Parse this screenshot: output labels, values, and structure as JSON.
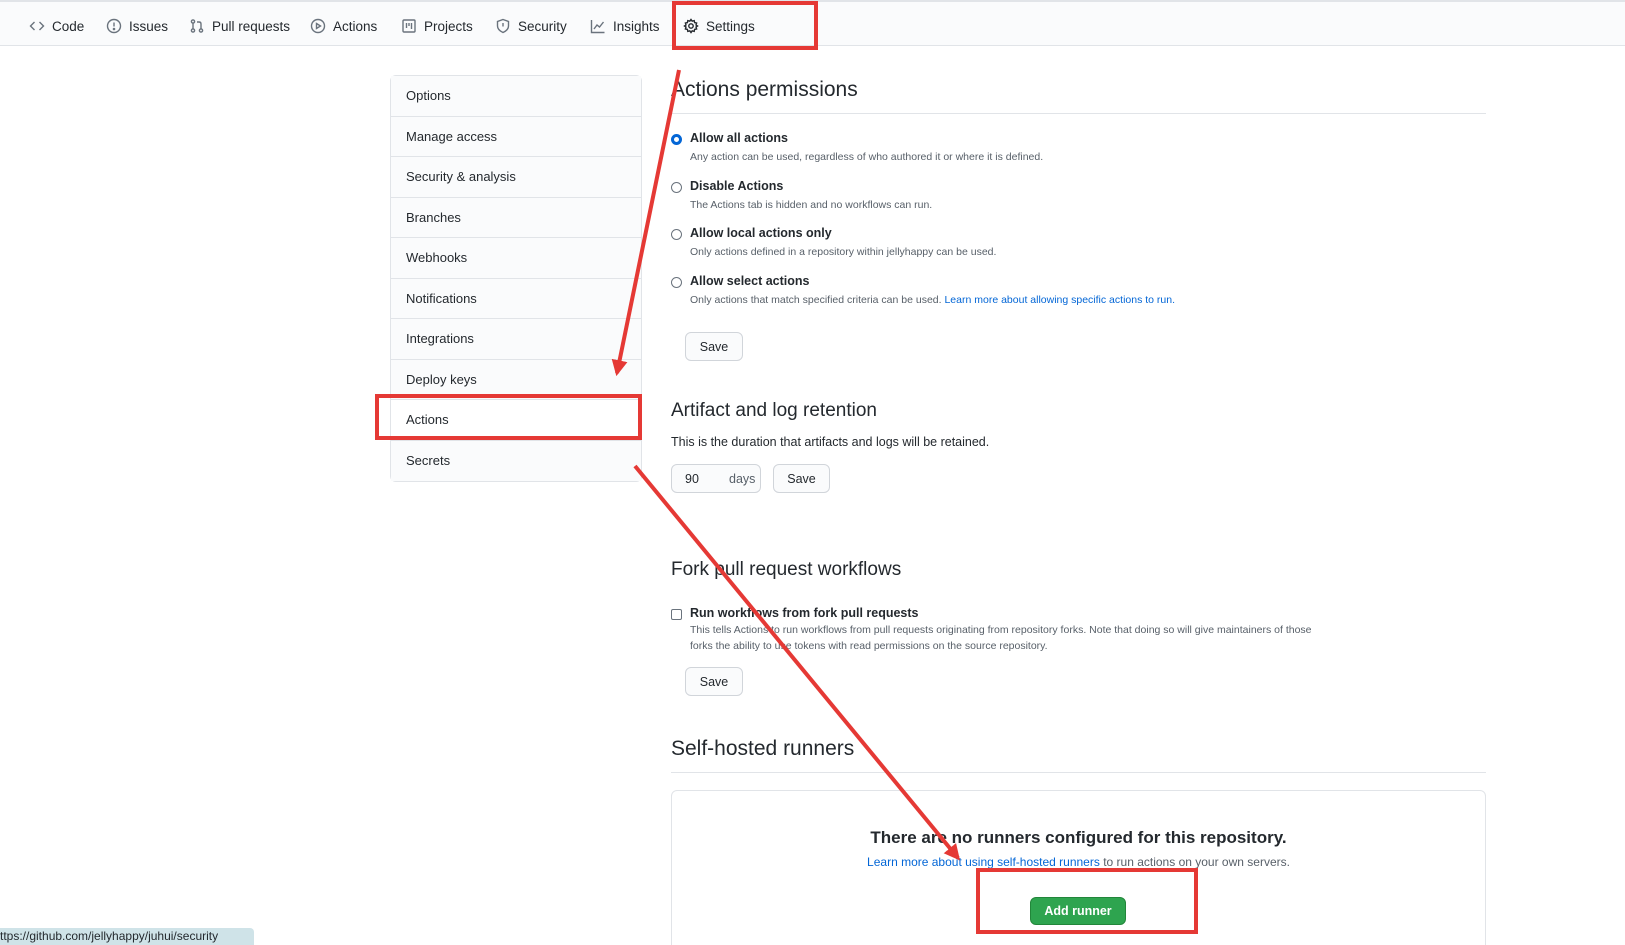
{
  "tabs": [
    {
      "label": "Code",
      "icon": "code-icon"
    },
    {
      "label": "Issues",
      "icon": "issue-icon"
    },
    {
      "label": "Pull requests",
      "icon": "pull-request-icon"
    },
    {
      "label": "Actions",
      "icon": "play-icon"
    },
    {
      "label": "Projects",
      "icon": "project-icon"
    },
    {
      "label": "Security",
      "icon": "shield-icon"
    },
    {
      "label": "Insights",
      "icon": "graph-icon"
    },
    {
      "label": "Settings",
      "icon": "gear-icon",
      "selected": true
    }
  ],
  "sidebar": {
    "items": [
      {
        "label": "Options"
      },
      {
        "label": "Manage access"
      },
      {
        "label": "Security & analysis"
      },
      {
        "label": "Branches"
      },
      {
        "label": "Webhooks"
      },
      {
        "label": "Notifications"
      },
      {
        "label": "Integrations"
      },
      {
        "label": "Deploy keys"
      },
      {
        "label": "Actions",
        "active": true
      },
      {
        "label": "Secrets"
      }
    ]
  },
  "permissions": {
    "title": "Actions permissions",
    "options": [
      {
        "title": "Allow all actions",
        "desc": "Any action can be used, regardless of who authored it or where it is defined.",
        "checked": true
      },
      {
        "title": "Disable Actions",
        "desc": "The Actions tab is hidden and no workflows can run.",
        "checked": false
      },
      {
        "title": "Allow local actions only",
        "desc": "Only actions defined in a repository within jellyhappy can be used.",
        "checked": false
      },
      {
        "title": "Allow select actions",
        "desc": "Only actions that match specified criteria can be used.",
        "link": "Learn more about allowing specific actions to run.",
        "checked": false
      }
    ],
    "save_label": "Save"
  },
  "retention": {
    "title": "Artifact and log retention",
    "desc": "This is the duration that artifacts and logs will be retained.",
    "days_value": "90",
    "days_unit": "days",
    "save_label": "Save"
  },
  "fork": {
    "title": "Fork pull request workflows",
    "option_title": "Run workflows from fork pull requests",
    "option_desc_1": "This tells Actions to run workflows from pull requests originating from repository forks. Note that doing so will give maintainers of those",
    "option_desc_2": "forks the ability to use tokens with read permissions on the source repository.",
    "checked": false,
    "save_label": "Save"
  },
  "runners": {
    "title": "Self-hosted runners",
    "blank_title": "There are no runners configured for this repository.",
    "blank_link": "Learn more about using self-hosted runners",
    "blank_suffix": " to run actions on your own servers.",
    "add_label": "Add runner"
  },
  "statusbar": {
    "url": "ttps://github.com/jellyhappy/juhui/security"
  },
  "colors": {
    "annotation": "#e53935",
    "accent": "#0366d6",
    "primary": "#2ea44f"
  }
}
